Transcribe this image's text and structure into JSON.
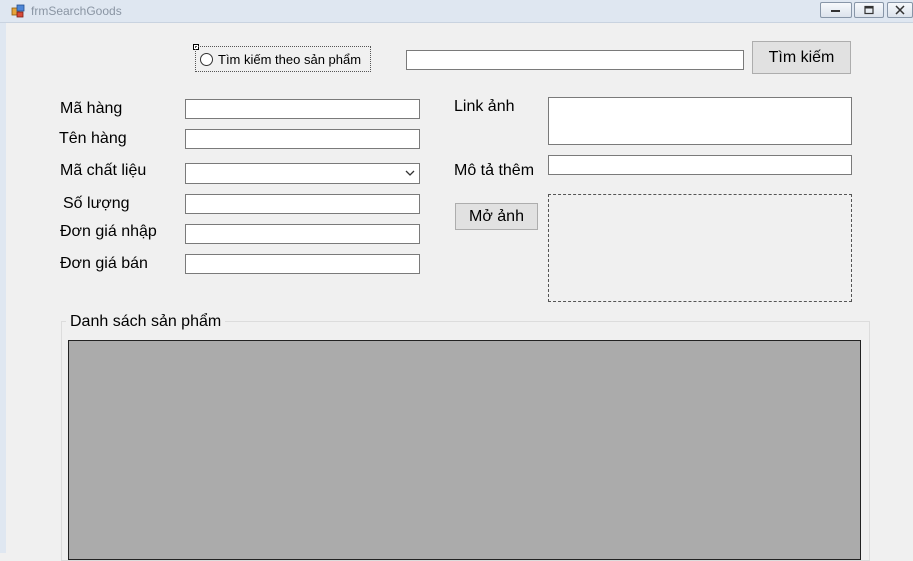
{
  "window": {
    "title": "frmSearchGoods"
  },
  "search": {
    "radio_label": "Tìm kiếm theo sản phẩm",
    "input_value": "",
    "button_label": "Tìm kiếm"
  },
  "form": {
    "ma_hang": {
      "label": "Mã hàng",
      "value": ""
    },
    "ten_hang": {
      "label": "Tên hàng",
      "value": ""
    },
    "ma_chat_lieu": {
      "label": "Mã chất liệu",
      "value": ""
    },
    "so_luong": {
      "label": "Số lượng",
      "value": ""
    },
    "don_gia_nhap": {
      "label": "Đơn giá nhập",
      "value": ""
    },
    "don_gia_ban": {
      "label": "Đơn giá bán",
      "value": ""
    },
    "link_anh": {
      "label": "Link ảnh",
      "value": ""
    },
    "mo_ta_them": {
      "label": "Mô tả thêm",
      "value": ""
    },
    "open_image_button": "Mở ảnh"
  },
  "list": {
    "group_title": "Danh sách sản phẩm"
  }
}
